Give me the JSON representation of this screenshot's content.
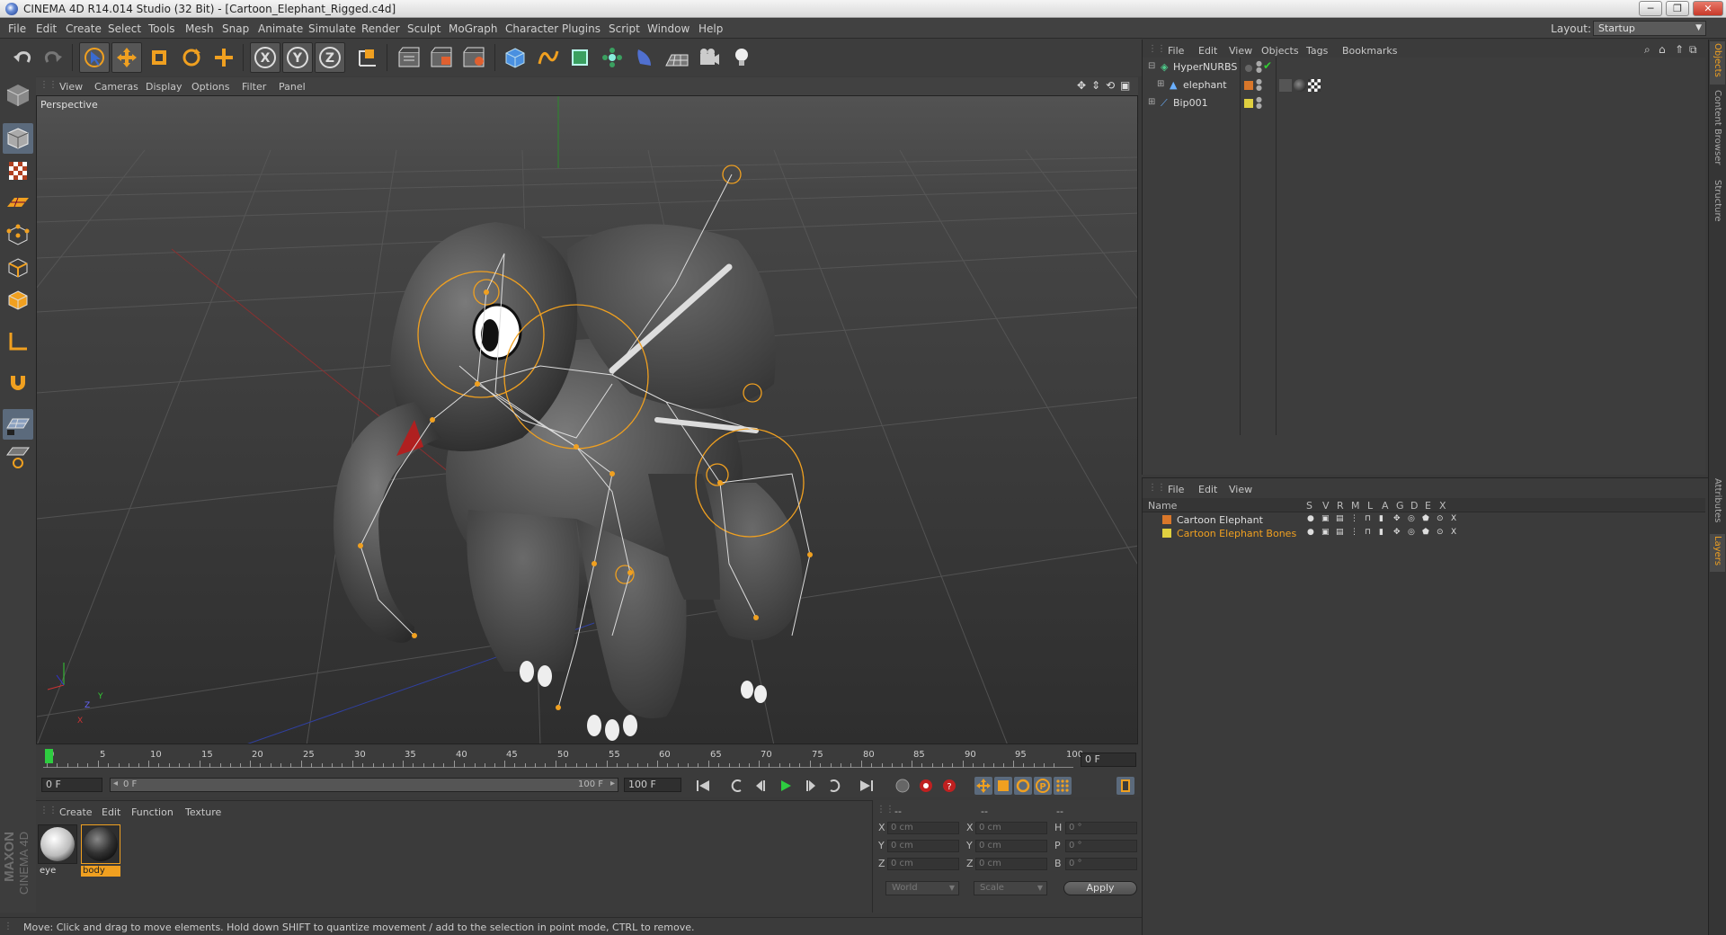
{
  "window": {
    "title": "CINEMA 4D R14.014 Studio (32 Bit) - [Cartoon_Elephant_Rigged.c4d]",
    "buttons": [
      "─",
      "❐",
      "✕"
    ]
  },
  "menubar": {
    "items": [
      "File",
      "Edit",
      "Create",
      "Select",
      "Tools",
      "Mesh",
      "Snap",
      "Animate",
      "Simulate",
      "Render",
      "Sculpt",
      "MoGraph",
      "Character",
      "Plugins",
      "Script",
      "Window",
      "Help"
    ],
    "layout_label": "Layout:",
    "layout_value": "Startup"
  },
  "toolbar": {
    "icons": [
      "undo-icon",
      "redo-icon",
      "live-select-icon",
      "move-icon",
      "scale-icon",
      "rotate-icon",
      "add-axis-icon",
      "x-axis-icon",
      "y-axis-icon",
      "z-axis-icon",
      "world-coord-icon",
      "render-view-icon",
      "render-picture-viewer-icon",
      "render-settings-icon",
      "cube-icon",
      "spline-icon",
      "nurbs-icon",
      "array-icon",
      "deformer-icon",
      "floor-icon",
      "camera-icon",
      "light-icon"
    ]
  },
  "viewport": {
    "menus": [
      "View",
      "Cameras",
      "Display",
      "Options",
      "Filter",
      "Panel"
    ],
    "label": "Perspective",
    "axis_labels": {
      "y": "Y",
      "x": "X",
      "z": "Z"
    }
  },
  "timeline": {
    "ticks": [
      "0",
      "5",
      "10",
      "15",
      "20",
      "25",
      "30",
      "35",
      "40",
      "45",
      "50",
      "55",
      "60",
      "65",
      "70",
      "75",
      "80",
      "85",
      "90",
      "95",
      "100"
    ],
    "current_frame": "0 F",
    "start_frame": "0 F",
    "range_start": "0 F",
    "range_end": "100 F",
    "end_frame": "100 F"
  },
  "material_manager": {
    "menus": [
      "Create",
      "Edit",
      "Function",
      "Texture"
    ],
    "materials": [
      {
        "name": "eye",
        "selected": false
      },
      {
        "name": "body",
        "selected": true
      }
    ],
    "brand_line1": "MAXON",
    "brand_line2": "CINEMA 4D"
  },
  "coordinates": {
    "header_dashes": [
      "--",
      "--",
      "--"
    ],
    "rows": [
      {
        "l1": "X",
        "v1": "0 cm",
        "l2": "X",
        "v2": "0 cm",
        "l3": "H",
        "v3": "0 °"
      },
      {
        "l1": "Y",
        "v1": "0 cm",
        "l2": "Y",
        "v2": "0 cm",
        "l3": "P",
        "v3": "0 °"
      },
      {
        "l1": "Z",
        "v1": "0 cm",
        "l2": "Z",
        "v2": "0 cm",
        "l3": "B",
        "v3": "0 °"
      }
    ],
    "mode1": "World",
    "mode2": "Scale",
    "apply": "Apply"
  },
  "status": {
    "text": "Move: Click and drag to move elements. Hold down SHIFT to quantize movement / add to the selection in point mode, CTRL to remove."
  },
  "object_manager": {
    "menus": [
      "File",
      "Edit",
      "View",
      "Objects",
      "Tags",
      "Bookmarks"
    ],
    "objects": [
      {
        "name": "HyperNURBS",
        "color": "#888888"
      },
      {
        "name": "elephant",
        "color": "#d9772a"
      },
      {
        "name": "Bip001",
        "color": "#e0d040"
      }
    ]
  },
  "layer_manager": {
    "menus": [
      "File",
      "Edit",
      "View"
    ],
    "columns": [
      "Name",
      "S",
      "V",
      "R",
      "M",
      "L",
      "A",
      "G",
      "D",
      "E",
      "X"
    ],
    "layers": [
      {
        "name": "Cartoon Elephant",
        "color": "#d9772a",
        "highlight": false
      },
      {
        "name": "Cartoon Elephant Bones",
        "color": "#e0d040",
        "highlight": true
      }
    ]
  },
  "side_tabs": {
    "top": [
      "Objects",
      "Content Browser",
      "Structure"
    ],
    "bottom": [
      "Attributes",
      "Layers"
    ]
  },
  "colors": {
    "accent_orange": "#f0a020",
    "selection_blue": "#4f7fc0",
    "play_green": "#2ecc40"
  }
}
